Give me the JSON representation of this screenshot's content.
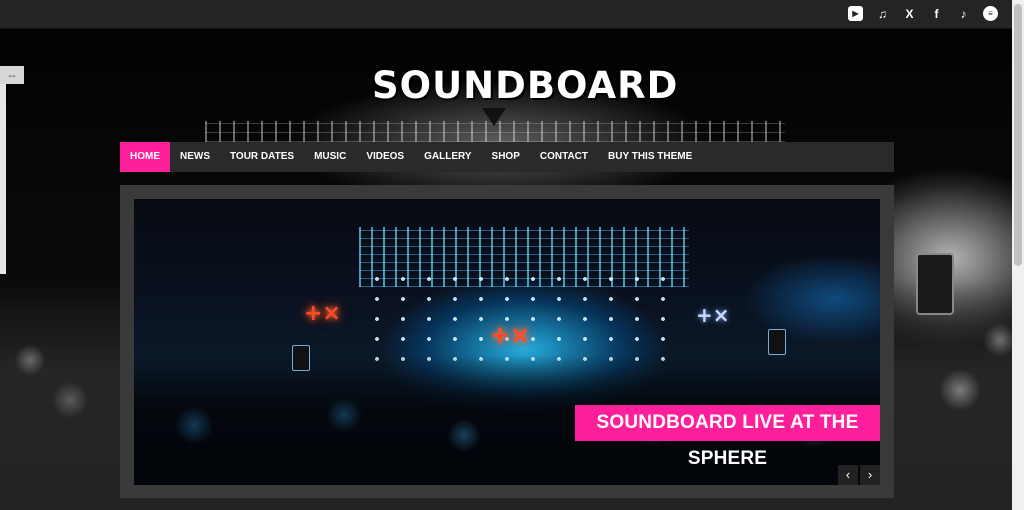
{
  "site": {
    "logo": "SOUNDBOARD"
  },
  "social_icons": [
    {
      "name": "youtube-icon",
      "glyph": "▶"
    },
    {
      "name": "music-note-icon",
      "glyph": "♫"
    },
    {
      "name": "x-icon",
      "glyph": "X"
    },
    {
      "name": "facebook-icon",
      "glyph": "f"
    },
    {
      "name": "tiktok-icon",
      "glyph": "♪"
    },
    {
      "name": "spotify-icon",
      "glyph": "≡"
    }
  ],
  "nav": {
    "items": [
      {
        "label": "HOME",
        "active": true
      },
      {
        "label": "NEWS"
      },
      {
        "label": "TOUR DATES"
      },
      {
        "label": "MUSIC"
      },
      {
        "label": "VIDEOS"
      },
      {
        "label": "GALLERY"
      },
      {
        "label": "SHOP"
      },
      {
        "label": "CONTACT"
      },
      {
        "label": "BUY THIS THEME"
      }
    ]
  },
  "slider": {
    "caption": "SOUNDBOARD LIVE AT THE SPHERE",
    "prev_glyph": "‹",
    "next_glyph": "›"
  },
  "sidetab": {
    "glyph": "⇔"
  },
  "colors": {
    "accent": "#ff1f9a",
    "nav_bg": "#2a2a2a",
    "topbar_bg": "#242424"
  }
}
